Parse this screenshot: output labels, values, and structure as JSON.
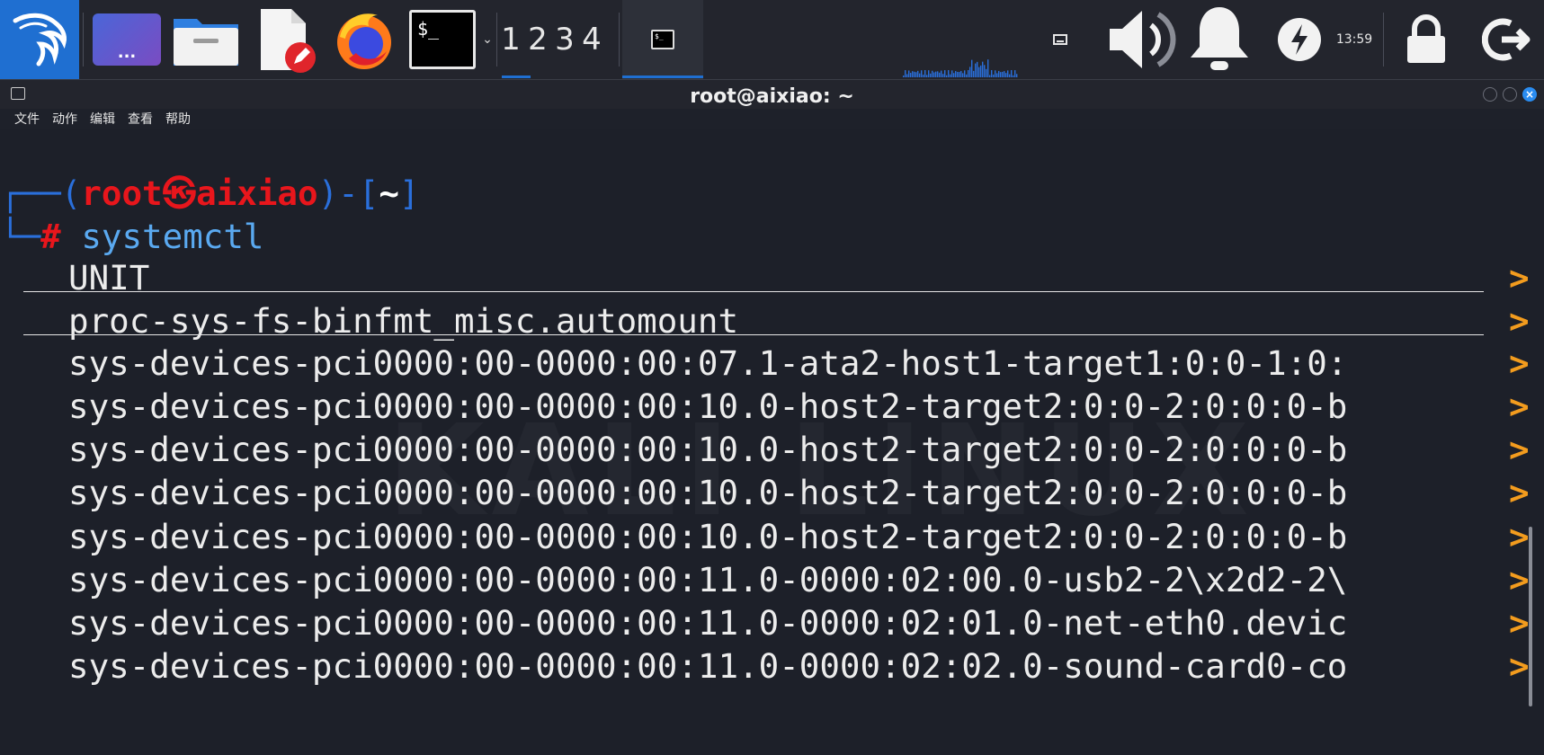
{
  "panel": {
    "desktop_label": "...",
    "terminal_prompt_glyph": "$_",
    "workspaces": [
      "1",
      "2",
      "3",
      "4"
    ],
    "clock": "13:59",
    "task_icon_text": "$_"
  },
  "window": {
    "title": "root@aixiao: ~",
    "close_glyph": "×"
  },
  "menu": {
    "items": [
      "文件",
      "动作",
      "编辑",
      "查看",
      "帮助"
    ]
  },
  "terminal": {
    "prompt": {
      "open": "┌──(",
      "user": "root",
      "at": "㉿",
      "host": "aixiao",
      "close": ")-[",
      "dir": "~",
      "end": "]",
      "line2": "└─",
      "hash": "#",
      "command": "systemctl"
    },
    "header": "UNIT",
    "rows": [
      "proc-sys-fs-binfmt_misc.automount",
      "sys-devices-pci0000:00-0000:00:07.1-ata2-host1-target1:0:0-1:0:",
      "sys-devices-pci0000:00-0000:00:10.0-host2-target2:0:0-2:0:0:0-b",
      "sys-devices-pci0000:00-0000:00:10.0-host2-target2:0:0-2:0:0:0-b",
      "sys-devices-pci0000:00-0000:00:10.0-host2-target2:0:0-2:0:0:0-b",
      "sys-devices-pci0000:00-0000:00:10.0-host2-target2:0:0-2:0:0:0-b",
      "sys-devices-pci0000:00-0000:00:11.0-0000:02:00.0-usb2-2\\x2d2-2\\",
      "sys-devices-pci0000:00-0000:00:11.0-0000:02:01.0-net-eth0.devic",
      "sys-devices-pci0000:00-0000:00:11.0-0000:02:02.0-sound-card0-co"
    ],
    "more_marker": ">"
  },
  "colors": {
    "prompt_red": "#e8161c",
    "prompt_blue": "#2a6fdb",
    "more_orange": "#f39c1e",
    "accent": "#1f6fd1"
  }
}
